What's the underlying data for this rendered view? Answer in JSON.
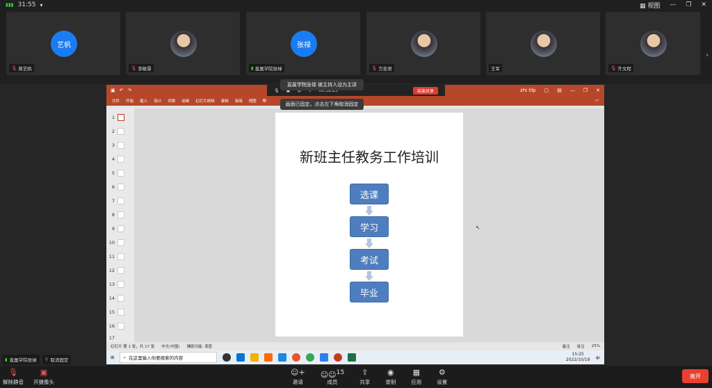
{
  "topbar": {
    "time": "31:55",
    "view_label": "视图"
  },
  "tiles": [
    {
      "initials": "艺帆",
      "name": "周艺帆",
      "type": "text",
      "mic": "muted"
    },
    {
      "initials": "",
      "name": "李敏慧",
      "type": "photo",
      "mic": "muted"
    },
    {
      "initials": "张禄",
      "name": "直属学院张禄",
      "type": "text",
      "mic": "active"
    },
    {
      "initials": "",
      "name": "方宏君",
      "type": "photo",
      "mic": "muted"
    },
    {
      "initials": "",
      "name": "王军",
      "type": "photo",
      "mic": "none"
    },
    {
      "initials": "",
      "name": "齐文程",
      "type": "photo",
      "mic": "muted"
    }
  ],
  "tooltips": {
    "host": "直属学院张禄 被主持人设为主讲",
    "pinned": "画面已固定，点击左下角取消固定"
  },
  "present_bar": {
    "timer": "00:38:23",
    "end_label": "结束共享"
  },
  "ppt": {
    "user": "zhi lilp",
    "menu": [
      "文件",
      "开始",
      "插入",
      "设计",
      "切换",
      "动画",
      "幻灯片放映",
      "录制",
      "审阅",
      "视图",
      "帮"
    ],
    "slide_title": "新班主任教务工作培训",
    "steps": [
      "选课",
      "学习",
      "考试",
      "毕业"
    ],
    "thumb_numbers": [
      "1",
      "2",
      "3",
      "4",
      "5",
      "6",
      "7",
      "8",
      "9",
      "10",
      "11",
      "12",
      "13",
      "14",
      "15",
      "16",
      "17"
    ],
    "status_left": "幻灯片 第 1 张，共 17 张",
    "status_lang": "中文(中国)",
    "status_access": "辅助功能: 调查",
    "status_notes": "备注",
    "status_comments": "批注",
    "zoom": "25%"
  },
  "taskbar": {
    "search_placeholder": "在这里输入你要搜索的内容",
    "time": "15:25",
    "date": "2022/10/19",
    "ime": "中"
  },
  "badges": {
    "speaker": "直属学院张禄",
    "unpin": "取消固定"
  },
  "bottom": {
    "unmute": "解除静音",
    "camera": "开摄像头",
    "invite": "邀请",
    "members": "成员",
    "members_count": "15",
    "share": "共享",
    "record": "录制",
    "apps": "应用",
    "settings": "设置",
    "leave": "离开"
  }
}
